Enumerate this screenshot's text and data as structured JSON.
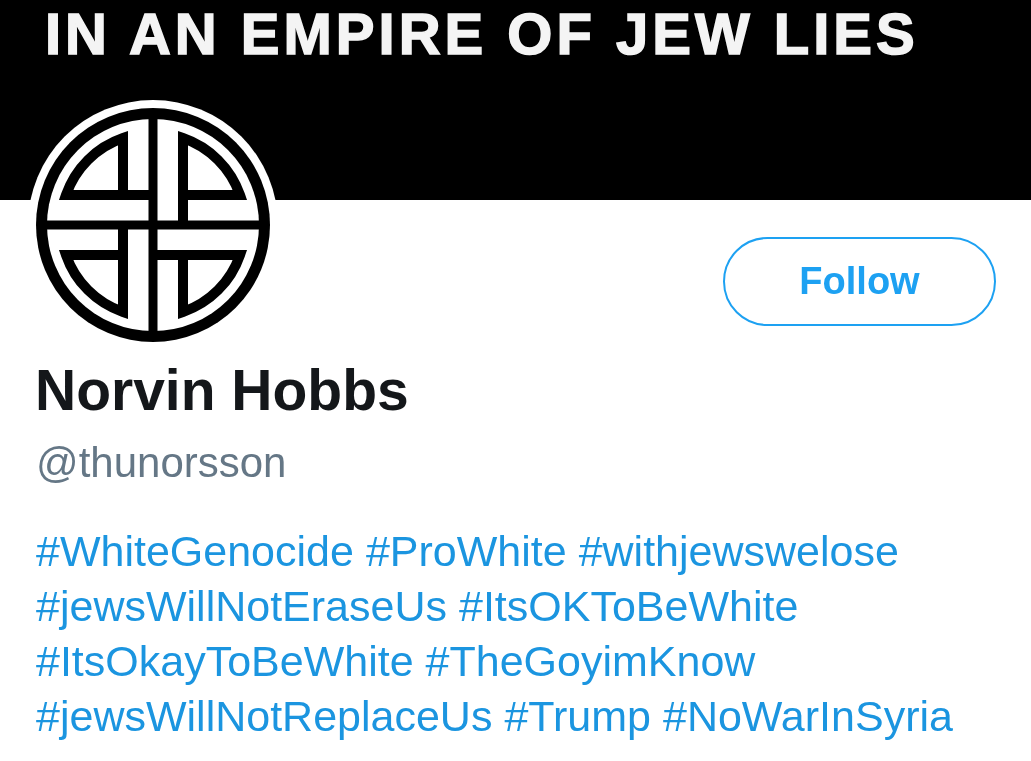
{
  "banner": {
    "text": "IN AN EMPIRE OF JEW LIES"
  },
  "profile": {
    "name": "Norvin Hobbs",
    "handle": "@thunorsson",
    "follow_button": {
      "label": "Follow"
    }
  },
  "bio": {
    "lines": [
      [
        "#WhiteGenocide",
        "#ProWhite",
        "#withjewswelose"
      ],
      [
        "#jewsWillNotEraseUs",
        "#ItsOKToBeWhite"
      ],
      [
        "#ItsOkayToBeWhite",
        "#TheGoyimKnow"
      ],
      [
        "#jewsWillNotReplaceUs",
        "#Trump",
        "#NoWarInSyria"
      ]
    ]
  }
}
